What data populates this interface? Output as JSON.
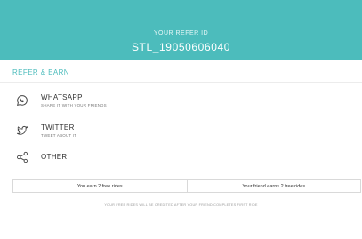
{
  "header": {
    "label": "YOUR REFER ID",
    "refer_id": "STL_19050606040",
    "background_color": "#4cbcbc"
  },
  "section": {
    "title": "REFER & EARN",
    "accent_color": "#4cbcbc"
  },
  "share_options": [
    {
      "title": "WHATSAPP",
      "subtitle": "SHARE IT WITH YOUR FRIENDS",
      "icon": "whatsapp-icon"
    },
    {
      "title": "TWITTER",
      "subtitle": "TWEET ABOUT IT",
      "icon": "twitter-icon"
    },
    {
      "title": "OTHER",
      "subtitle": "",
      "icon": "share-icon"
    }
  ],
  "rides": {
    "you_earn": "You earn 2 free rides",
    "friend_earns": "Your friend earns 2 free rides"
  },
  "footnote": "YOUR FREE RIDES WILL BE CREDITED AFTER YOUR FRIEND COMPLETES FIRST RIDE"
}
